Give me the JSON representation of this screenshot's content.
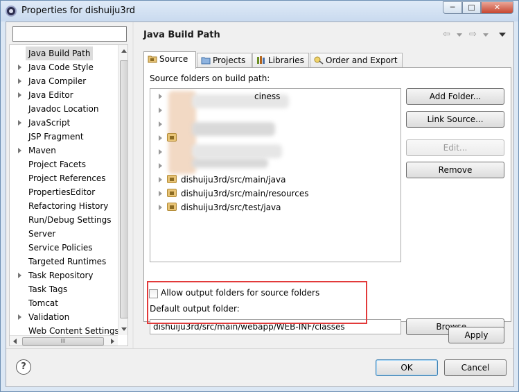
{
  "window": {
    "title": "Properties for dishuiju3rd"
  },
  "filter": {
    "value": ""
  },
  "tree": {
    "items": [
      {
        "label": "Java Build Path",
        "expandable": false,
        "selected": true
      },
      {
        "label": "Java Code Style",
        "expandable": true
      },
      {
        "label": "Java Compiler",
        "expandable": true
      },
      {
        "label": "Java Editor",
        "expandable": true
      },
      {
        "label": "Javadoc Location",
        "expandable": false
      },
      {
        "label": "JavaScript",
        "expandable": true
      },
      {
        "label": "JSP Fragment",
        "expandable": false
      },
      {
        "label": "Maven",
        "expandable": true
      },
      {
        "label": "Project Facets",
        "expandable": false
      },
      {
        "label": "Project References",
        "expandable": false
      },
      {
        "label": "PropertiesEditor",
        "expandable": false
      },
      {
        "label": "Refactoring History",
        "expandable": false
      },
      {
        "label": "Run/Debug Settings",
        "expandable": false
      },
      {
        "label": "Server",
        "expandable": false
      },
      {
        "label": "Service Policies",
        "expandable": false
      },
      {
        "label": "Targeted Runtimes",
        "expandable": false
      },
      {
        "label": "Task Repository",
        "expandable": true
      },
      {
        "label": "Task Tags",
        "expandable": false
      },
      {
        "label": "Tomcat",
        "expandable": false
      },
      {
        "label": "Validation",
        "expandable": true
      },
      {
        "label": "Web Content Settings",
        "expandable": false
      }
    ],
    "hscroll_thumb": "III"
  },
  "page": {
    "title": "Java Build Path"
  },
  "tabs": [
    {
      "label": "Source",
      "active": true,
      "icon": "source-folder-icon"
    },
    {
      "label": "Projects",
      "active": false,
      "icon": "projects-icon"
    },
    {
      "label": "Libraries",
      "active": false,
      "icon": "libraries-icon"
    },
    {
      "label": "Order and Export",
      "active": false,
      "icon": "order-export-icon"
    }
  ],
  "source": {
    "list_label": "Source folders on build path:",
    "partial_first_item": "ciness",
    "items": [
      "dishuiju3rd/src/main/java",
      "dishuiju3rd/src/main/resources",
      "dishuiju3rd/src/test/java"
    ],
    "buttons": {
      "add_folder": "Add Folder...",
      "link_source": "Link Source...",
      "edit": "Edit...",
      "remove": "Remove"
    },
    "allow_output_label": "Allow output folders for source folders",
    "allow_output_checked": false,
    "default_output_label": "Default output folder:",
    "default_output_value": "dishuiju3rd/src/main/webapp/WEB-INF/classes",
    "browse": "Browse..."
  },
  "apply": "Apply",
  "ok": "OK",
  "cancel": "Cancel",
  "colors": {
    "highlight_box": "#e23a3a",
    "default_button_border": "#3c7fb1"
  }
}
